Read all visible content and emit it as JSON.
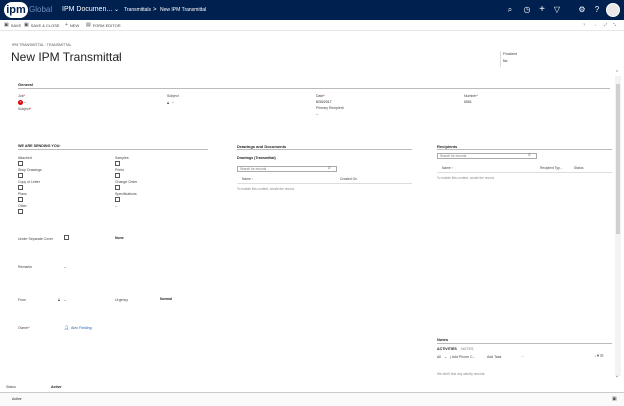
{
  "topbar": {
    "logo_ipm": "ipm",
    "logo_global": "Global",
    "app_title": "IPM Documen...",
    "crumb_area": "Transmittals",
    "crumb_sep": ">",
    "crumb_record": "New IPM Transmittal"
  },
  "toolbar": {
    "save": "SAVE",
    "save_close": "SAVE & CLOSE",
    "new": "NEW",
    "form_editor": "FORM EDITOR"
  },
  "header": {
    "entity": "IPM TRANSMITTAL : TRANSMITTAL",
    "title": "New IPM Transmittal",
    "finalized_label": "Finalized",
    "finalized_value": "No"
  },
  "general": {
    "title": "General",
    "job_label": "Job",
    "job_value": "--",
    "subject_label": "Subject",
    "subject_value": "--",
    "date_label": "Date",
    "date_value": "8/30/2017",
    "number_label": "Number",
    "number_value": "0001",
    "subject2_label": "Subject",
    "primary_recipient_label": "Primary Recipient",
    "primary_recipient_value": "--"
  },
  "sending": {
    "title": "WE ARE SENDING YOU:",
    "left_items": [
      "Attached",
      "Shop Drawings",
      "Copy of Letter",
      "Plans",
      "Other"
    ],
    "right_items": [
      "Samples",
      "Prints",
      "Change Order",
      "Specifications"
    ],
    "dash": "--",
    "separate_cover_label": "Under Separate Cover",
    "separate_cover_value": "None",
    "remarks_label": "Remarks",
    "remarks_value": "--",
    "from_label": "From",
    "from_value": "--",
    "urgency_label": "Urgency",
    "urgency_value": "Normal",
    "owner_label": "Owner",
    "owner_value": "Alex Fielding"
  },
  "drawings": {
    "title": "Drawings and Documents",
    "subgrid_title": "Drawings (Transmittal)",
    "search_placeholder": "Search for records",
    "col_name": "Name ↑",
    "col_created": "Created On",
    "empty": "To enable this content, create the record."
  },
  "recipients": {
    "title": "Recipients",
    "search_placeholder": "Search for records",
    "col_name": "Name ↑",
    "col_type": "Recipient Typ...",
    "col_status": "Status",
    "empty": "To enable this content, create the record."
  },
  "notes": {
    "title": "Notes",
    "tab_activities": "ACTIVITIES",
    "tab_notes": "NOTES",
    "filter_all": "All",
    "add_phone": "Add Phone C...",
    "add_task": "Add Task",
    "more": "...",
    "empty": "We didn't find any activity records."
  },
  "status": {
    "label": "Status",
    "value": "Active",
    "footer_value": "Active"
  },
  "icons": [
    "search-icon",
    "history-icon",
    "plus-icon",
    "filter-icon",
    "gear-icon",
    "help-icon",
    "save-icon",
    "new-icon",
    "form-editor-icon",
    "lock-icon",
    "user-icon"
  ]
}
